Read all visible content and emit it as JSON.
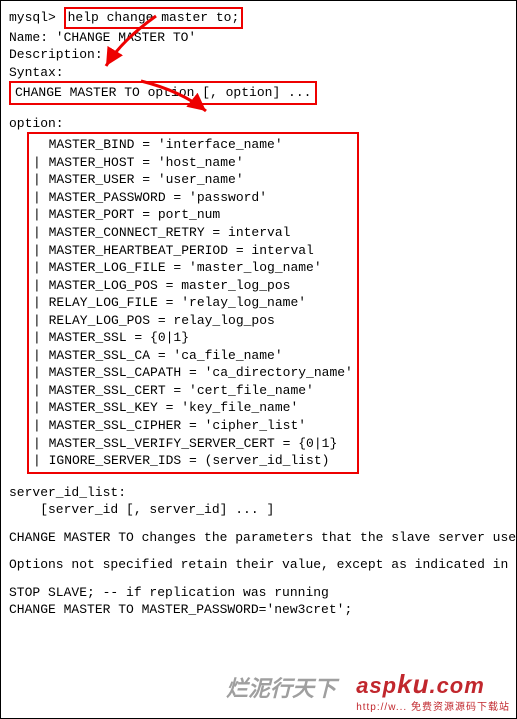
{
  "prompt": "mysql>",
  "command": "help change master to;",
  "name_line": "Name: 'CHANGE MASTER TO'",
  "desc_label": "Description:",
  "syntax_label": "Syntax:",
  "syntax_line": "CHANGE MASTER TO option [, option] ...",
  "option_label": "option:",
  "options": [
    "MASTER_BIND = 'interface_name'",
    "MASTER_HOST = 'host_name'",
    "MASTER_USER = 'user_name'",
    "MASTER_PASSWORD = 'password'",
    "MASTER_PORT = port_num",
    "MASTER_CONNECT_RETRY = interval",
    "MASTER_HEARTBEAT_PERIOD = interval",
    "MASTER_LOG_FILE = 'master_log_name'",
    "MASTER_LOG_POS = master_log_pos",
    "RELAY_LOG_FILE = 'relay_log_name'",
    "RELAY_LOG_POS = relay_log_pos",
    "MASTER_SSL = {0|1}",
    "MASTER_SSL_CA = 'ca_file_name'",
    "MASTER_SSL_CAPATH = 'ca_directory_name'",
    "MASTER_SSL_CERT = 'cert_file_name'",
    "MASTER_SSL_KEY = 'key_file_name'",
    "MASTER_SSL_CIPHER = 'cipher_list'",
    "MASTER_SSL_VERIFY_SERVER_CERT = {0|1}",
    "IGNORE_SERVER_IDS = (server_id_list)"
  ],
  "server_id_list_label": "server_id_list:",
  "server_id_list_body": "    [server_id [, server_id] ... ]",
  "para1": "CHANGE MASTER TO changes the parameters that the slave server uses for connecting to the master server, for reading the master binary log, and reading the slave relay log. It also updates the contents of the master.info and relay-log.info files. To use CHANGE MASTER TO, the slave replication threads must be stopped (use STOP SLAVE if necessary).",
  "para2": "Options not specified retain their value, except as indicated in the following discussion. Thus, in most cases, there is no need to specify options that do not change. For example, if the password to connect to your MySQL master has changed, you just need to issue these statements to tell the slave about the new password:",
  "stop_slave": "STOP SLAVE; -- if replication was running",
  "change_pw": "CHANGE MASTER TO MASTER_PASSWORD='new3cret';",
  "watermark_cn": "烂泥行天下",
  "watermark_brand": "asp",
  "watermark_brand_k": "ku",
  "watermark_brand_com": ".com",
  "watermark_url": "http://w... 免费资源源码下载站"
}
